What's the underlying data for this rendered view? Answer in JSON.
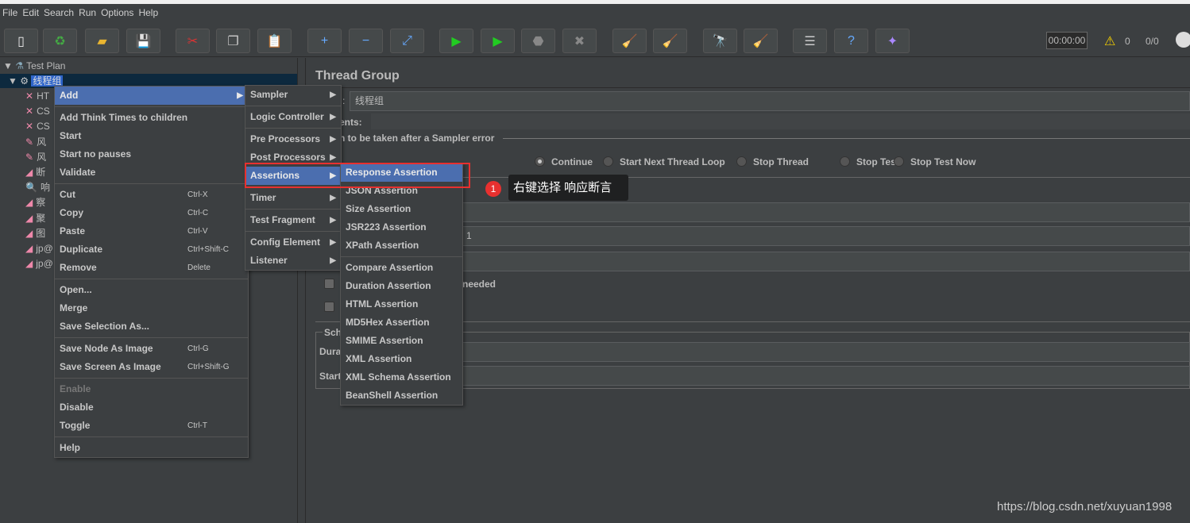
{
  "menubar": [
    "File",
    "Edit",
    "Search",
    "Run",
    "Options",
    "Help"
  ],
  "toolbar": {
    "icons": [
      "new-icon",
      "templates-icon",
      "open-icon",
      "save-icon",
      "cut-icon",
      "copy-icon",
      "paste-icon",
      "expand-icon",
      "collapse-icon",
      "toggle-icon",
      "start-icon",
      "start-no-pause-icon",
      "stop-icon",
      "shutdown-icon",
      "clear-icon",
      "clear-all-icon",
      "search-icon",
      "reset-search-icon",
      "function-helper-icon",
      "help-icon",
      "remote-icon"
    ],
    "timer": "00:00:00",
    "warnings": "0",
    "threads": "0/0"
  },
  "tree": {
    "root": "Test Plan",
    "selected": "线程组",
    "children": [
      "HT",
      "CS",
      "CS",
      "风",
      "风",
      "断",
      "响",
      "察",
      "聚",
      "图",
      "jp@",
      "jp@"
    ]
  },
  "context_menu": {
    "items": [
      {
        "label": "Add",
        "arrow": true,
        "selected": true
      },
      {
        "sep": true
      },
      {
        "label": "Add Think Times to children"
      },
      {
        "label": "Start"
      },
      {
        "label": "Start no pauses"
      },
      {
        "label": "Validate"
      },
      {
        "sep": true
      },
      {
        "label": "Cut",
        "shortcut": "Ctrl-X"
      },
      {
        "label": "Copy",
        "shortcut": "Ctrl-C"
      },
      {
        "label": "Paste",
        "shortcut": "Ctrl-V"
      },
      {
        "label": "Duplicate",
        "shortcut": "Ctrl+Shift-C"
      },
      {
        "label": "Remove",
        "shortcut": "Delete"
      },
      {
        "sep": true
      },
      {
        "label": "Open..."
      },
      {
        "label": "Merge"
      },
      {
        "label": "Save Selection As..."
      },
      {
        "sep": true
      },
      {
        "label": "Save Node As Image",
        "shortcut": "Ctrl-G"
      },
      {
        "label": "Save Screen As Image",
        "shortcut": "Ctrl+Shift-G"
      },
      {
        "sep": true
      },
      {
        "label": "Enable",
        "disabled": true
      },
      {
        "label": "Disable"
      },
      {
        "label": "Toggle",
        "shortcut": "Ctrl-T"
      },
      {
        "sep": true
      },
      {
        "label": "Help"
      }
    ]
  },
  "add_menu": {
    "items": [
      {
        "label": "Sampler",
        "arrow": true
      },
      {
        "sep": true
      },
      {
        "label": "Logic Controller",
        "arrow": true
      },
      {
        "sep": true
      },
      {
        "label": "Pre Processors",
        "arrow": true
      },
      {
        "label": "Post Processors",
        "arrow": true
      },
      {
        "label": "Assertions",
        "arrow": true,
        "selected": true
      },
      {
        "sep": true
      },
      {
        "label": "Timer",
        "arrow": true
      },
      {
        "sep": true
      },
      {
        "label": "Test Fragment",
        "arrow": true
      },
      {
        "sep": true
      },
      {
        "label": "Config Element",
        "arrow": true
      },
      {
        "label": "Listener",
        "arrow": true
      }
    ]
  },
  "assertions_menu": {
    "items": [
      {
        "label": "Response Assertion",
        "selected": true
      },
      {
        "label": "JSON Assertion"
      },
      {
        "label": "Size Assertion"
      },
      {
        "label": "JSR223 Assertion"
      },
      {
        "label": "XPath Assertion"
      },
      {
        "sep": true
      },
      {
        "label": "Compare Assertion"
      },
      {
        "label": "Duration Assertion"
      },
      {
        "label": "HTML Assertion"
      },
      {
        "label": "MD5Hex Assertion"
      },
      {
        "label": "SMIME Assertion"
      },
      {
        "label": "XML Assertion"
      },
      {
        "label": "XML Schema Assertion"
      },
      {
        "label": "BeanShell Assertion"
      }
    ]
  },
  "annotation": {
    "badge": "1",
    "text": "右键选择 响应断言",
    "highlight_color": "#e8302f"
  },
  "panel": {
    "title": "Thread Group",
    "name_label_tail": ":",
    "name_value": "线程组",
    "comments_tail": "ents:",
    "action_tail": "n to be taken after a Sampler error",
    "radios": [
      {
        "label": "Continue",
        "checked": true
      },
      {
        "label": "Start Next Thread Loop"
      },
      {
        "label": "Stop Thread"
      },
      {
        "label": "Stop Test"
      },
      {
        "label": "Stop Test Now"
      }
    ],
    "field2_tail": "1",
    "checkbox1_tail": "needed",
    "scheduler_tail": "Sch",
    "duration_tail": "Dura",
    "start_tail": "Start"
  },
  "watermark": "https://blog.csdn.net/xuyuan1998"
}
